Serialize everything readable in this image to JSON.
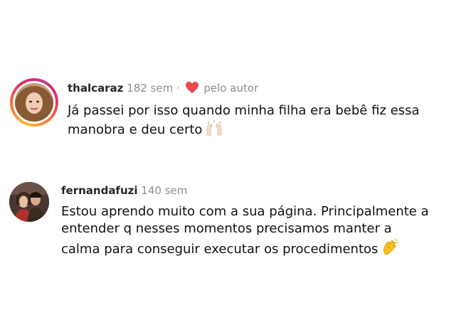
{
  "comments": [
    {
      "username": "thalcaraz",
      "time": "182 sem",
      "separator": "·",
      "liked_by_author_label": "pelo autor",
      "text_lines": [
        "Já passei por isso quando minha filha era bebê fiz essa",
        "manobra e deu certo"
      ],
      "emoji": "raising-hands-icon"
    },
    {
      "username": "fernandafuzi",
      "time": "140 sem",
      "text_lines": [
        "Estou aprendo muito com a sua página. Principalmente a",
        "entender q nesses momentos precisamos manter a",
        "calma para conseguir executar os procedimentos"
      ],
      "emoji": "clapping-hands-icon"
    }
  ],
  "colors": {
    "username": "#262626",
    "meta": "#8e8e8e",
    "heart": "#ed4956",
    "text": "#111111"
  }
}
